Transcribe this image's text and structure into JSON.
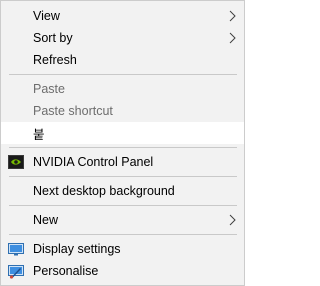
{
  "menu": {
    "view": "View",
    "sort_by": "Sort by",
    "refresh": "Refresh",
    "paste": "Paste",
    "paste_shortcut": "Paste shortcut",
    "ime_item": "붙",
    "nvidia": "NVIDIA Control Panel",
    "next_background": "Next desktop background",
    "new": "New",
    "display_settings": "Display settings",
    "personalise": "Personalise"
  },
  "colors": {
    "menu_bg": "#f2f2f2",
    "separator": "#c9c9c9",
    "disabled_text": "#6d6d6d",
    "highlight_bg": "#ffffff",
    "nvidia_green": "#76b900"
  },
  "icons": {
    "nvidia": "nvidia-icon",
    "display": "monitor-icon",
    "personalise": "personalise-icon",
    "submenu": "chevron-right-icon"
  }
}
